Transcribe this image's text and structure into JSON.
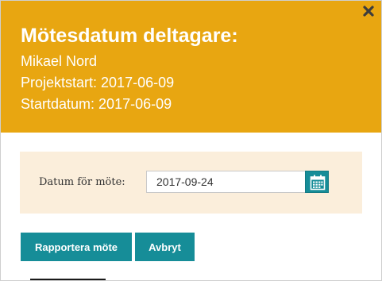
{
  "dialog": {
    "title": "Mötesdatum deltagare:",
    "participant": "Mikael Nord",
    "project_start": "Projektstart: 2017-06-09",
    "start_date": "Startdatum: 2017-06-09",
    "close_icon": "close-icon",
    "header_color": "#e8a611"
  },
  "form": {
    "date_label": "Datum för möte:",
    "date_value": "2017-09-24",
    "calendar_icon": "calendar-icon",
    "panel_color": "#fbeedb"
  },
  "actions": {
    "report_label": "Rapportera möte",
    "cancel_label": "Avbryt",
    "button_color": "#168d98"
  }
}
